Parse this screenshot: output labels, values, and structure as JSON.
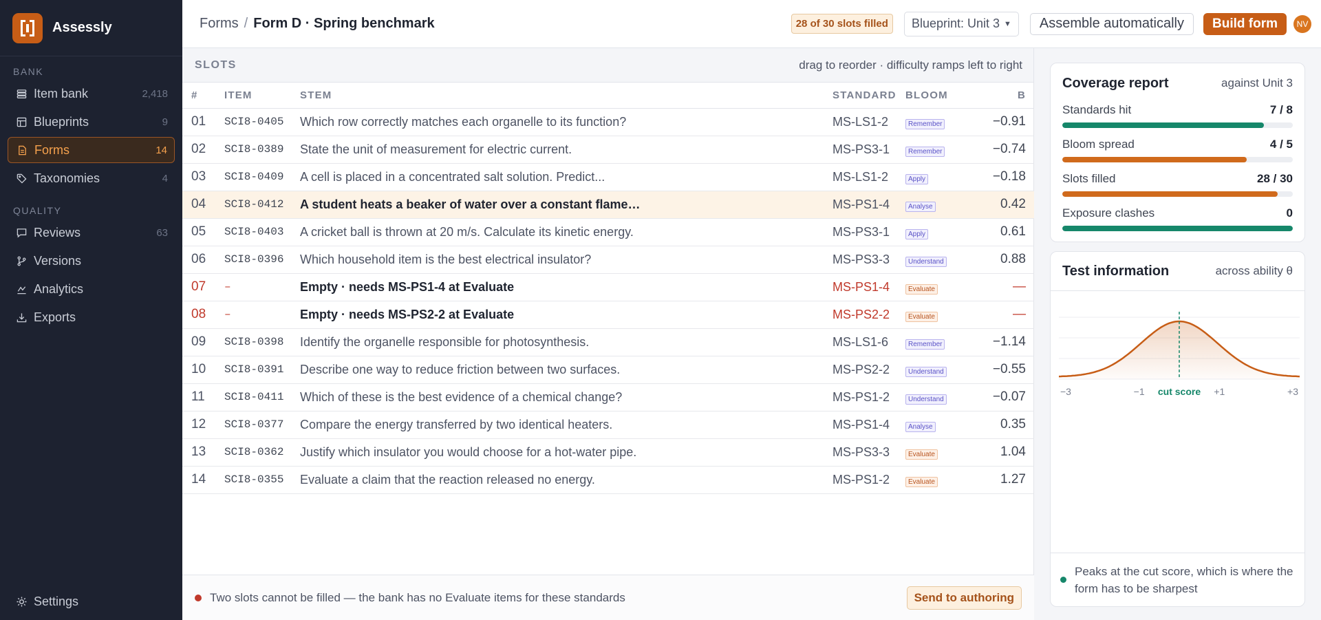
{
  "app": {
    "name": "Assessly"
  },
  "sidebar": {
    "section_bank": "BANK",
    "section_quality": "QUALITY",
    "bank_items": [
      {
        "label": "Item bank",
        "count": "2,418",
        "icon": "stack-icon"
      },
      {
        "label": "Blueprints",
        "count": "9",
        "icon": "grid-icon"
      },
      {
        "label": "Forms",
        "count": "14",
        "icon": "document-icon",
        "active": true
      },
      {
        "label": "Taxonomies",
        "count": "4",
        "icon": "tag-icon"
      }
    ],
    "quality_items": [
      {
        "label": "Reviews",
        "count": "63",
        "icon": "chat-icon"
      },
      {
        "label": "Versions",
        "count": "",
        "icon": "branch-icon"
      },
      {
        "label": "Analytics",
        "count": "",
        "icon": "chart-icon"
      },
      {
        "label": "Exports",
        "count": "",
        "icon": "download-icon"
      }
    ],
    "settings": "Settings"
  },
  "topbar": {
    "breadcrumb_root": "Forms",
    "breadcrumb_sep": "/",
    "breadcrumb_current": "Form D · Spring benchmark",
    "slots_badge": "28 of 30 slots filled",
    "blueprint_select": "Blueprint: Unit 3",
    "assemble_button": "Assemble automatically",
    "build_button": "Build form",
    "avatar_initials": "NV"
  },
  "slots": {
    "title": "SLOTS",
    "hint": "drag to reorder · difficulty ramps left to right",
    "columns": [
      "#",
      "ITEM",
      "STEM",
      "STANDARD",
      "BLOOM",
      "B"
    ],
    "rows": [
      {
        "num": "01",
        "item": "SCI8-0405",
        "stem": "Which row correctly matches each organelle to its function?",
        "standard": "MS-LS1-2",
        "bloom": "Remember",
        "b": "−0.91"
      },
      {
        "num": "02",
        "item": "SCI8-0389",
        "stem": "State the unit of measurement for electric current.",
        "standard": "MS-PS3-1",
        "bloom": "Remember",
        "b": "−0.74"
      },
      {
        "num": "03",
        "item": "SCI8-0409",
        "stem": "A cell is placed in a concentrated salt solution. Predict...",
        "standard": "MS-LS1-2",
        "bloom": "Apply",
        "b": "−0.18"
      },
      {
        "num": "04",
        "item": "SCI8-0412",
        "stem": "A student heats a beaker of water over a constant flame…",
        "standard": "MS-PS1-4",
        "bloom": "Analyse",
        "b": "0.42",
        "state": "hl"
      },
      {
        "num": "05",
        "item": "SCI8-0403",
        "stem": "A cricket ball is thrown at 20 m/s. Calculate its kinetic energy.",
        "standard": "MS-PS3-1",
        "bloom": "Apply",
        "b": "0.61"
      },
      {
        "num": "06",
        "item": "SCI8-0396",
        "stem": "Which household item is the best electrical insulator?",
        "standard": "MS-PS3-3",
        "bloom": "Understand",
        "b": "0.88"
      },
      {
        "num": "07",
        "item": "–",
        "stem": "Empty · needs MS-PS1-4 at Evaluate",
        "standard": "MS-PS1-4",
        "bloom": "Evaluate",
        "b": "—",
        "state": "empty"
      },
      {
        "num": "08",
        "item": "–",
        "stem": "Empty · needs MS-PS2-2 at Evaluate",
        "standard": "MS-PS2-2",
        "bloom": "Evaluate",
        "b": "—",
        "state": "empty"
      },
      {
        "num": "09",
        "item": "SCI8-0398",
        "stem": "Identify the organelle responsible for photosynthesis.",
        "standard": "MS-LS1-6",
        "bloom": "Remember",
        "b": "−1.14"
      },
      {
        "num": "10",
        "item": "SCI8-0391",
        "stem": "Describe one way to reduce friction between two surfaces.",
        "standard": "MS-PS2-2",
        "bloom": "Understand",
        "b": "−0.55"
      },
      {
        "num": "11",
        "item": "SCI8-0411",
        "stem": "Which of these is the best evidence of a chemical change?",
        "standard": "MS-PS1-2",
        "bloom": "Understand",
        "b": "−0.07"
      },
      {
        "num": "12",
        "item": "SCI8-0377",
        "stem": "Compare the energy transferred by two identical heaters.",
        "standard": "MS-PS1-4",
        "bloom": "Analyse",
        "b": "0.35"
      },
      {
        "num": "13",
        "item": "SCI8-0362",
        "stem": "Justify which insulator you would choose for a hot-water pipe.",
        "standard": "MS-PS3-3",
        "bloom": "Evaluate",
        "b": "1.04"
      },
      {
        "num": "14",
        "item": "SCI8-0355",
        "stem": "Evaluate a claim that the reaction released no energy.",
        "standard": "MS-PS1-2",
        "bloom": "Evaluate",
        "b": "1.27"
      }
    ],
    "footer_message": "Two slots cannot be filled — the bank has no Evaluate items for these standards",
    "send_button": "Send to authoring"
  },
  "coverage": {
    "title": "Coverage report",
    "subtitle": "against Unit 3",
    "metrics": [
      {
        "label": "Standards hit",
        "value": "7 / 8",
        "fraction": 0.875,
        "color": "#16876a"
      },
      {
        "label": "Bloom spread",
        "value": "4 / 5",
        "fraction": 0.8,
        "color": "#d06a1c"
      },
      {
        "label": "Slots filled",
        "value": "28 / 30",
        "fraction": 0.933,
        "color": "#d06a1c"
      },
      {
        "label": "Exposure clashes",
        "value": "0",
        "fraction": 1.0,
        "color": "#16876a"
      }
    ]
  },
  "test_info": {
    "title": "Test information",
    "subtitle": "across ability θ",
    "footer": "Peaks at the cut score, which is where the form has to be sharpest"
  },
  "chart_data": {
    "type": "area",
    "x_ticks": [
      "−3",
      "−1",
      "cut score",
      "+1",
      "+3"
    ],
    "xlim": [
      -3,
      3
    ],
    "cut_score": 0,
    "series": [
      {
        "x": [
          -3,
          -2,
          -1,
          0,
          1,
          2,
          3
        ],
        "y": [
          0.05,
          0.3,
          0.8,
          1.0,
          0.8,
          0.3,
          0.05
        ]
      }
    ],
    "color": "#c75d16",
    "cut_color": "#16876a"
  }
}
